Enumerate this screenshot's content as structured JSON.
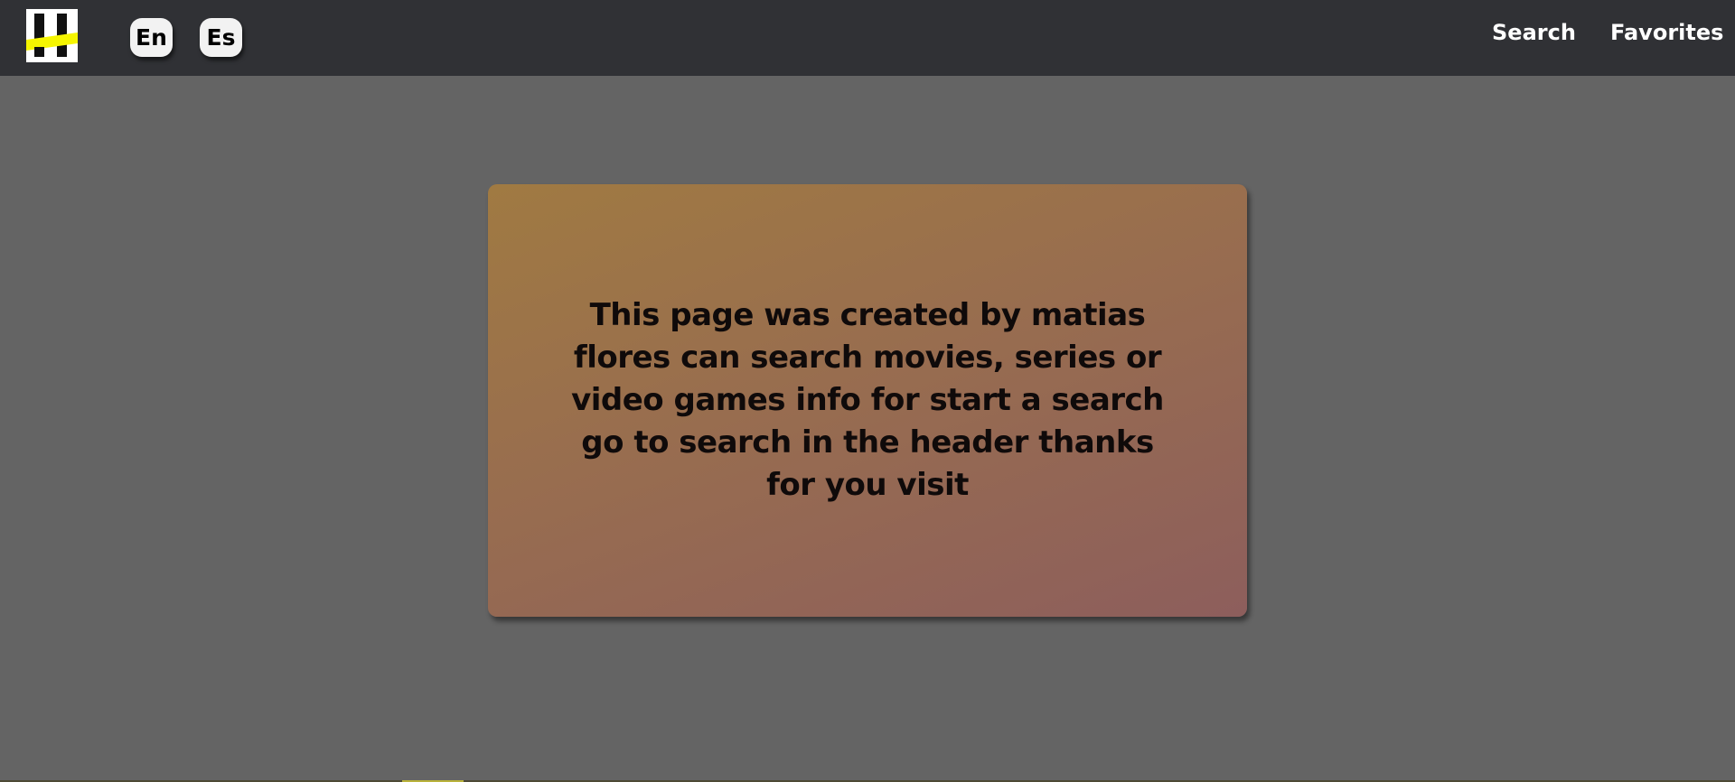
{
  "header": {
    "lang_en": "En",
    "lang_es": "Es",
    "nav_search": "Search",
    "nav_favorites": "Favorites"
  },
  "logo": {
    "icon": "logo-icon",
    "colors": {
      "background": "#ffffff",
      "bars": "#111111",
      "stripe": "#f5f500"
    }
  },
  "main": {
    "about_text": "This page was created by matias flores can search movies, series or video games info for start a search go to search in the header thanks for you visit"
  },
  "colors": {
    "header_bg": "#303135",
    "page_bg": "#646464",
    "card_gradient_start": "#a07a42",
    "card_gradient_end": "#8d5e5c",
    "text_dark": "#0f0a0a"
  }
}
